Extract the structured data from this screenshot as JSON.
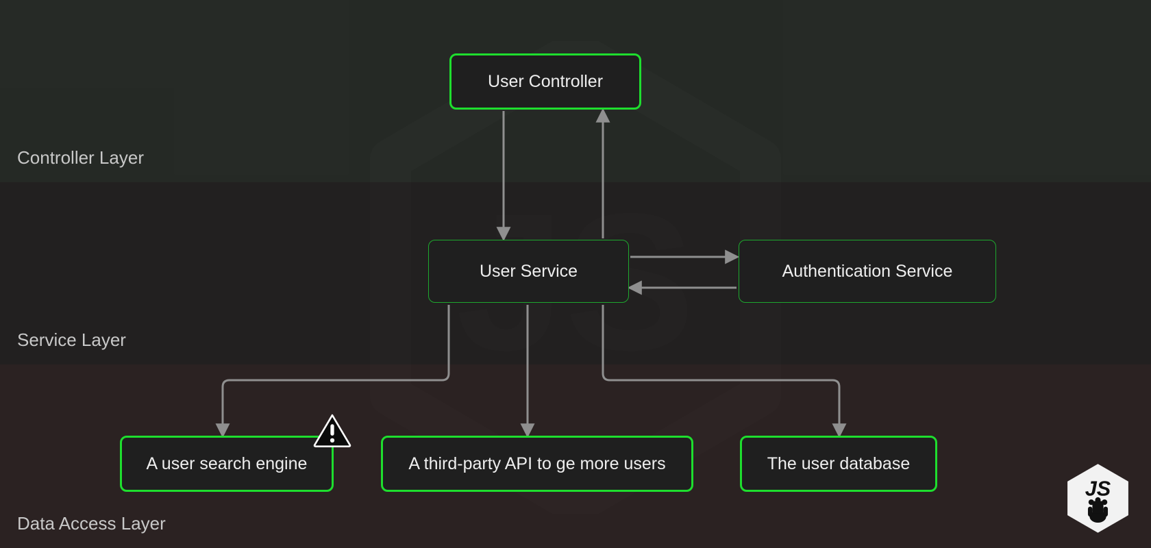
{
  "layers": {
    "controller": "Controller Layer",
    "service": "Service Layer",
    "data": "Data Access Layer"
  },
  "nodes": {
    "user_controller": "User Controller",
    "user_service": "User  Service",
    "auth_service": "Authentication Service",
    "search_engine": "A user search engine",
    "third_party": "A third-party API to ge more users",
    "user_db": "The user database"
  },
  "icons": {
    "warning": "warning-icon",
    "logo": "nodejs-logo"
  },
  "colors": {
    "node_bg": "#1f1f1f",
    "border_bright": "#1EDE2E",
    "border_dim": "#1EA82E",
    "arrow": "#8f8f8f",
    "text": "#eeeeee",
    "label": "#c8c8c8"
  }
}
